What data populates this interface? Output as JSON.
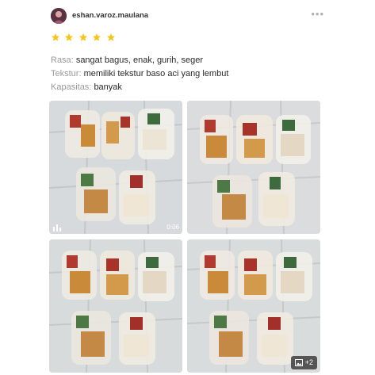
{
  "review": {
    "username": "eshan.varoz.maulana",
    "rating": 5,
    "lines": [
      {
        "label": "Rasa:",
        "value": "sangat bagus, enak, gurih, seger"
      },
      {
        "label": "Tekstur:",
        "value": "memiliki tekstur baso aci yang lembut"
      },
      {
        "label": "Kapasitas:",
        "value": "banyak"
      }
    ]
  },
  "media": {
    "video_duration": "0:06",
    "more_count": "+2"
  },
  "icons": {
    "avatar": "user-avatar-photo",
    "more": "more-dots-icon",
    "star": "star-icon",
    "video": "video-bars-icon",
    "image": "image-icon"
  },
  "colors": {
    "star": "#f5c518",
    "label": "#9a9a9a"
  }
}
